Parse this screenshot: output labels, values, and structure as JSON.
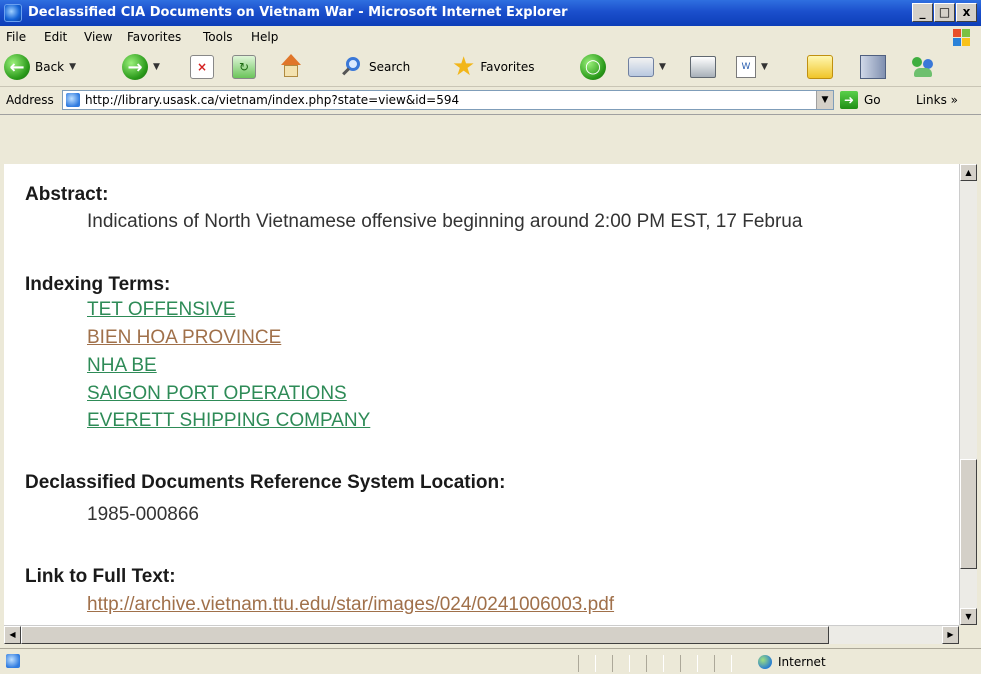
{
  "window": {
    "title": "Declassified CIA Documents on Vietnam War - Microsoft Internet Explorer",
    "buttons": {
      "minimize": "_",
      "maximize": "□",
      "close": "x"
    }
  },
  "menu": {
    "file": "File",
    "edit": "Edit",
    "view": "View",
    "favorites": "Favorites",
    "tools": "Tools",
    "help": "Help"
  },
  "toolbar": {
    "back_label": "Back",
    "search_label": "Search",
    "favorites_label": "Favorites"
  },
  "address": {
    "label": "Address",
    "url": "http://library.usask.ca/vietnam/index.php?state=view&id=594",
    "go_label": "Go",
    "links_label": "Links »"
  },
  "document": {
    "abstract_heading": "Abstract:",
    "abstract_text": "Indications of North Vietnamese offensive beginning around 2:00 PM EST, 17 Februa",
    "indexing_heading": "Indexing Terms:",
    "indexing_terms": [
      "TET OFFENSIVE",
      "BIEN HOA PROVINCE",
      "NHA BE",
      "SAIGON PORT OPERATIONS",
      "EVERETT SHIPPING COMPANY"
    ],
    "location_heading": "Declassified Documents Reference System Location:",
    "location_value": "1985-000866",
    "fulltext_heading": "Link to Full Text:",
    "fulltext_url": "http://archive.vietnam.ttu.edu/star/images/024/0241006003.pdf"
  },
  "status": {
    "zone_label": "Internet"
  },
  "colors": {
    "link_green": "#2e8b57",
    "link_visited": "#a0704a",
    "titlebar_blue": "#1b4fcc"
  }
}
